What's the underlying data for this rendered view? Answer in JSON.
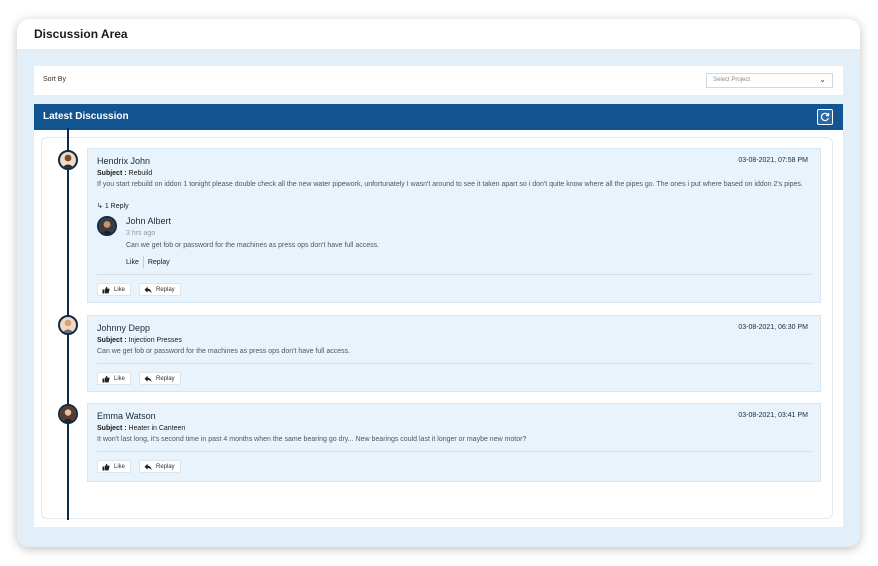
{
  "page": {
    "title": "Discussion Area"
  },
  "sort": {
    "label": "Sort By",
    "select_placeholder": "Select Project"
  },
  "panel": {
    "title": "Latest Discussion"
  },
  "discussions": [
    {
      "author": "Hendrix John",
      "date": "03-08-2021, 07:58 PM",
      "subject_label": "Subject :",
      "subject": "Rebuild",
      "message": "If you start rebuild on iddon 1 tonight please double check all the new water pipework, unfortunately I wasn't around to see it taken apart so i don't quite know where all the pipes go. The ones i put where based on iddon 2's pipes.",
      "reply_count": "1 Reply",
      "reply": {
        "author": "John Albert",
        "time": "3 hrs ago",
        "message": "Can we get fob or password for the machines as press ops don't have full access.",
        "like_label": "Like",
        "replay_label": "Replay"
      },
      "like_label": "Like",
      "replay_label": "Replay"
    },
    {
      "author": "Johnny Depp",
      "date": "03-08-2021, 06:30 PM",
      "subject_label": "Subject :",
      "subject": "Injection Presses",
      "message": "Can we get fob or password for the machines as press ops don't have full access.",
      "like_label": "Like",
      "replay_label": "Replay"
    },
    {
      "author": "Emma Watson",
      "date": "03-08-2021, 03:41 PM",
      "subject_label": "Subject :",
      "subject": "Heater in Canteen",
      "message": "It won't last long, it's second time in past 4 months when the same bearing go dry... New bearings could last it longer or maybe new motor?",
      "like_label": "Like",
      "replay_label": "Replay"
    }
  ],
  "icons": {
    "refresh": "refresh-icon",
    "chevron": "chevron-down-icon",
    "like": "thumbs-up-icon",
    "replay": "reply-arrow-icon",
    "reply_count": "reply-corner-icon"
  },
  "colors": {
    "header": "#135592",
    "background": "#e2eef8",
    "card": "#e8f3fc",
    "timeline": "#0e2a4a"
  }
}
